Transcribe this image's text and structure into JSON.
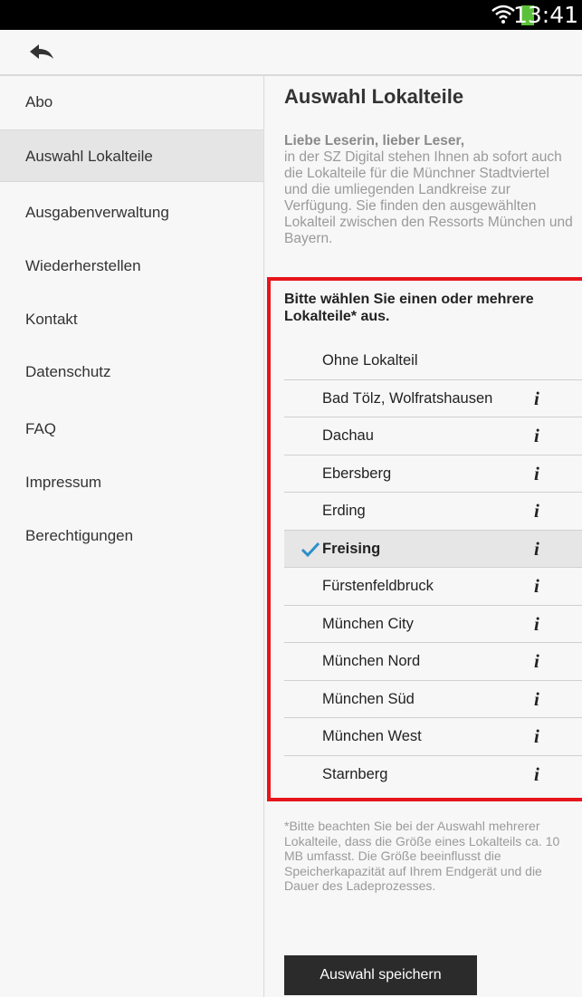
{
  "status_bar": {
    "time": "13:41",
    "wifi_icon": "wifi-icon",
    "battery_color": "#5cc13a"
  },
  "app_bar": {
    "back_icon": "back-arrow-icon"
  },
  "sidebar": {
    "items": [
      {
        "label": "Abo",
        "active": false
      },
      {
        "label": "Auswahl Lokalteile",
        "active": true
      },
      {
        "label": "Ausgabenverwaltung",
        "active": false
      },
      {
        "label": "Wiederherstellen",
        "active": false
      },
      {
        "label": "Kontakt",
        "active": false
      },
      {
        "label": "Datenschutz",
        "active": false
      },
      {
        "label": "FAQ",
        "active": false
      },
      {
        "label": "Impressum",
        "active": false
      },
      {
        "label": "Berechtigungen",
        "active": false
      }
    ]
  },
  "main": {
    "title": "Auswahl Lokalteile",
    "greeting": "Liebe Leserin, lieber Leser,",
    "intro": "in der SZ Digital stehen Ihnen ab sofort auch die Lokalteile für die Münchner Stadtviertel und die umliegenden Landkreise zur Verfügung. Sie finden den ausgewählten Lokalteil zwischen den Ressorts München und Bayern.",
    "prompt": "Bitte wählen Sie einen oder mehrere Lokalteile* aus.",
    "options": [
      {
        "label": "Ohne Lokalteil",
        "selected": false,
        "info": ""
      },
      {
        "label": "Bad Tölz, Wolfratshausen",
        "selected": false,
        "info": "i"
      },
      {
        "label": "Dachau",
        "selected": false,
        "info": "i"
      },
      {
        "label": "Ebersberg",
        "selected": false,
        "info": "i"
      },
      {
        "label": "Erding",
        "selected": false,
        "info": "i"
      },
      {
        "label": "Freising",
        "selected": true,
        "info": "i"
      },
      {
        "label": "Fürstenfeldbruck",
        "selected": false,
        "info": "i"
      },
      {
        "label": "München City",
        "selected": false,
        "info": "i"
      },
      {
        "label": "München Nord",
        "selected": false,
        "info": "i"
      },
      {
        "label": "München Süd",
        "selected": false,
        "info": "i"
      },
      {
        "label": "München West",
        "selected": false,
        "info": "i"
      },
      {
        "label": "Starnberg",
        "selected": false,
        "info": "i"
      }
    ],
    "footnote": "*Bitte beachten Sie bei der Auswahl mehrerer Lokalteile, dass die Größe eines Lokalteils ca. 10 MB umfasst. Die Größe beeinflusst die Speicherkapazität auf Ihrem Endgerät und die Dauer des Ladeprozesses.",
    "save_label": "Auswahl speichern"
  },
  "colors": {
    "highlight_border": "#e8141c",
    "check": "#2a8fc9",
    "button_bg": "#2b2b2b"
  }
}
